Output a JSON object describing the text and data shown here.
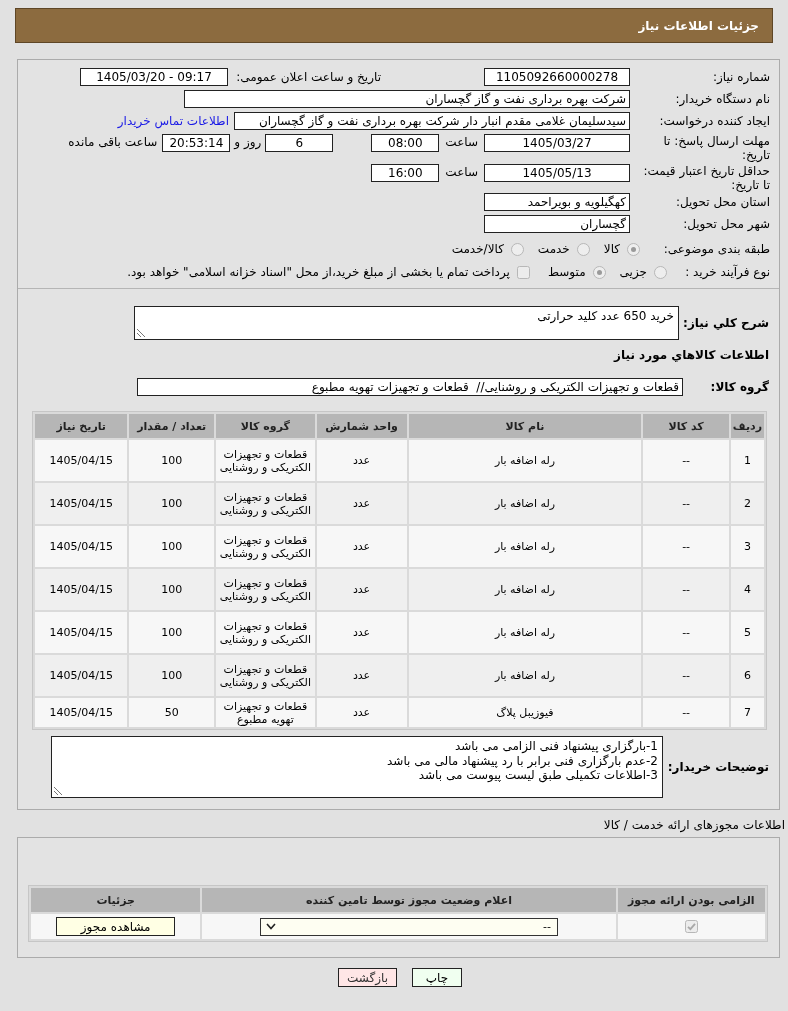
{
  "header": {
    "title": "جزئیات اطلاعات نیاز"
  },
  "need_info": {
    "need_number": {
      "label": "شماره نیاز:",
      "value": "1105092660000278"
    },
    "announcement": {
      "label": "تاریخ و ساعت اعلان عمومی:",
      "value": "1405/03/20 - 09:17"
    },
    "buyer_org": {
      "label": "نام دستگاه خریدار:",
      "value": "شرکت بهره برداری نفت و گاز گچساران"
    },
    "requester": {
      "label": "ایجاد کننده درخواست:",
      "value": "سیدسلیمان غلامی مقدم انبار دار شرکت بهره برداری نفت و گاز گچساران",
      "link": "اطلاعات تماس خریدار"
    },
    "response_deadline": {
      "label": "مهلت ارسال پاسخ: تا تاریخ:",
      "date": "1405/03/27",
      "time_label": "ساعت",
      "time": "08:00",
      "days": "6",
      "days_label": "روز و",
      "remaining": "20:53:14",
      "remaining_label": "ساعت باقی مانده"
    },
    "price_validity": {
      "label": "حداقل تاریخ اعتبار قیمت: تا تاریخ:",
      "date": "1405/05/13",
      "time_label": "ساعت",
      "time": "16:00"
    },
    "delivery_province": {
      "label": "استان محل تحویل:",
      "value": "کهگیلویه و بویراحمد"
    },
    "delivery_city": {
      "label": "شهر محل تحویل:",
      "value": "گچساران"
    },
    "subject_category": {
      "label": "طبقه بندی موضوعی:",
      "disabled": true,
      "options": [
        {
          "label": "کالا",
          "selected": true
        },
        {
          "label": "خدمت",
          "selected": false
        },
        {
          "label": "کالا/خدمت",
          "selected": false
        }
      ]
    },
    "purchase_process": {
      "label": "نوع فرآیند خرید :",
      "disabled": true,
      "options": [
        {
          "label": "جزیی",
          "selected": false
        },
        {
          "label": "متوسط",
          "selected": true
        }
      ],
      "treasury_payment": {
        "label": "پرداخت تمام یا بخشی از مبلغ خرید،از محل \"اسناد خزانه اسلامی\" خواهد بود.",
        "checked": false,
        "disabled": true
      }
    }
  },
  "summary": {
    "label": "شرح کلي نياز:",
    "value": "خرید 650 عدد کلید حرارتی"
  },
  "goods": {
    "title": "اطلاعات کالاهاي مورد نياز",
    "group_label": "گروه کالا:",
    "group_value": "قطعات و تجهیزات الکتریکی و روشنایی//  قطعات و تجهیزات تهویه مطبوع",
    "table": {
      "columns": [
        "ردیف",
        "کد کالا",
        "نام کالا",
        "واحد شمارش",
        "گروه کالا",
        "تعداد / مقدار",
        "تاریخ نیاز"
      ],
      "rows": [
        [
          "1",
          "--",
          "رله اضافه بار",
          "عدد",
          "قطعات و تجهیزات الکتریکی و روشنایی",
          "100",
          "1405/04/15"
        ],
        [
          "2",
          "--",
          "رله اضافه بار",
          "عدد",
          "قطعات و تجهیزات الکتریکی و روشنایی",
          "100",
          "1405/04/15"
        ],
        [
          "3",
          "--",
          "رله اضافه بار",
          "عدد",
          "قطعات و تجهیزات الکتریکی و روشنایی",
          "100",
          "1405/04/15"
        ],
        [
          "4",
          "--",
          "رله اضافه بار",
          "عدد",
          "قطعات و تجهیزات الکتریکی و روشنایی",
          "100",
          "1405/04/15"
        ],
        [
          "5",
          "--",
          "رله اضافه بار",
          "عدد",
          "قطعات و تجهیزات الکتریکی و روشنایی",
          "100",
          "1405/04/15"
        ],
        [
          "6",
          "--",
          "رله اضافه بار",
          "عدد",
          "قطعات و تجهیزات الکتریکی و روشنایی",
          "100",
          "1405/04/15"
        ],
        [
          "7",
          "--",
          "فیوزیبل پلاگ",
          "عدد",
          "قطعات و تجهیزات تهویه مطبوع",
          "50",
          "1405/04/15"
        ]
      ]
    }
  },
  "buyer_notes": {
    "label": "توضیحات خریدار:",
    "lines": [
      "1-بارگزاری پیشنهاد فنی الزامی می باشد",
      "2-عدم بارگزاری فنی برابر با رد پیشنهاد مالی می باشد",
      "3-اطلاعات تکمیلی طبق لیست پیوست می باشد"
    ]
  },
  "licenses": {
    "title": "اطلاعات مجوزهای ارائه خدمت / کالا",
    "table": {
      "columns": [
        "الزامی بودن ارائه مجوز",
        "اعلام وضعیت مجوز توسط تامین کننده",
        "جزئیات"
      ],
      "rows": [
        {
          "required": {
            "checked": true,
            "disabled": true
          },
          "status": "--",
          "details_button": "مشاهده مجوز"
        }
      ]
    }
  },
  "buttons": [
    {
      "label": "چاپ",
      "kind": "print"
    },
    {
      "label": "بازگشت",
      "kind": "back"
    }
  ]
}
